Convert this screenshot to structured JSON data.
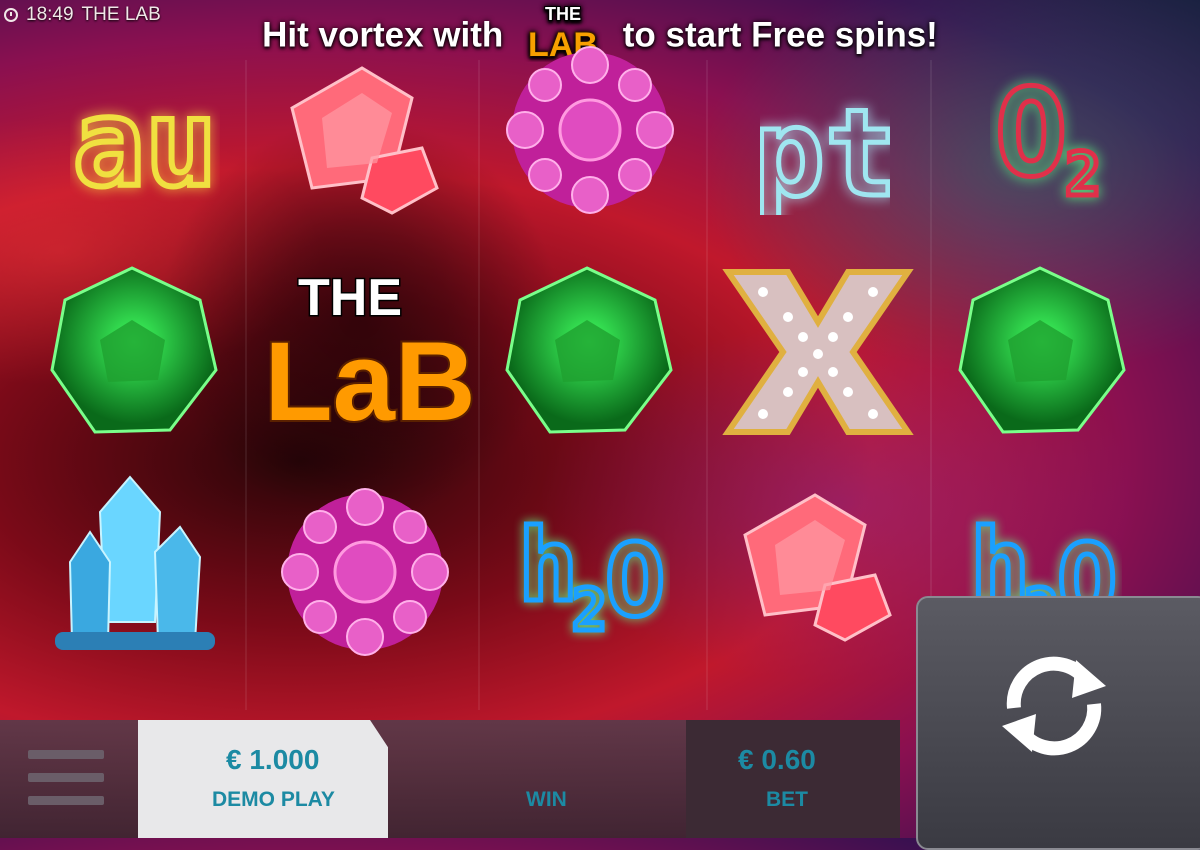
{
  "status": {
    "time": "18:49",
    "app": "THE LAB"
  },
  "banner": {
    "prefix": "Hit vortex with",
    "logo_top": "THE",
    "logo_bottom": "LAB",
    "suffix": "to start Free spins!"
  },
  "reels": [
    [
      "au",
      "red-crystal",
      "green-gem",
      "blue-crystal"
    ],
    [
      "red-crystal",
      "the-lab-wild",
      "purple-orb"
    ],
    [
      "purple-orb",
      "green-gem",
      "h2o"
    ],
    [
      "pt",
      "x-symbol",
      "red-crystal"
    ],
    [
      "o2",
      "green-gem",
      "h2o"
    ]
  ],
  "symbols": {
    "au": "au",
    "pt": "pt",
    "o2": {
      "main": "O",
      "sub": "2"
    },
    "h2o": {
      "h": "h",
      "sub": "2",
      "o": "O"
    },
    "the_lab": {
      "top": "THE",
      "bottom": "LaB"
    }
  },
  "hud": {
    "balance_value": "€ 1.000",
    "balance_label": "DEMO PLAY",
    "win_label": "WIN",
    "bet_value": "€ 0.60",
    "bet_label": "BET"
  },
  "colors": {
    "accent": "#1c8aa3",
    "au": "#f0e040",
    "pt": "#9fe6f0",
    "o2": "#e0304a",
    "h2o": "#1aa0ff"
  }
}
